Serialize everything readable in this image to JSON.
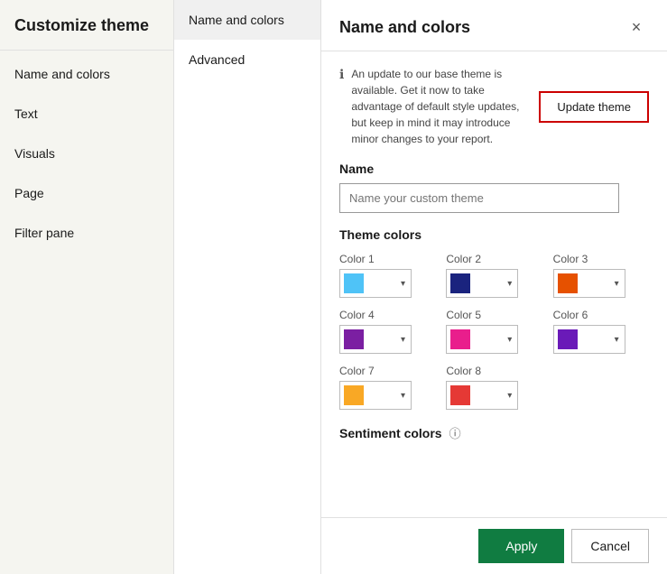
{
  "sidebar": {
    "title": "Customize theme",
    "nav_items": [
      {
        "id": "name-and-colors",
        "label": "Name and colors"
      },
      {
        "id": "text",
        "label": "Text"
      },
      {
        "id": "visuals",
        "label": "Visuals"
      },
      {
        "id": "page",
        "label": "Page"
      },
      {
        "id": "filter-pane",
        "label": "Filter pane"
      }
    ]
  },
  "middle_panel": {
    "tabs": [
      {
        "id": "name-and-colors-tab",
        "label": "Name and colors",
        "active": true
      },
      {
        "id": "advanced-tab",
        "label": "Advanced",
        "active": false
      }
    ]
  },
  "main": {
    "title": "Name and colors",
    "close_label": "×",
    "info_text": "An update to our base theme is available. Get it now to take advantage of default style updates, but keep in mind it may introduce minor changes to your report.",
    "update_theme_label": "Update theme",
    "name_section_label": "Name",
    "name_placeholder": "Name your custom theme",
    "theme_colors_label": "Theme colors",
    "colors": [
      {
        "id": "color1",
        "label": "Color 1",
        "value": "#4FC3F7",
        "hex": "#4FC3F7"
      },
      {
        "id": "color2",
        "label": "Color 2",
        "value": "#1A237E",
        "hex": "#1A237E"
      },
      {
        "id": "color3",
        "label": "Color 3",
        "value": "#E65100",
        "hex": "#E65100"
      },
      {
        "id": "color4",
        "label": "Color 4",
        "value": "#7B1FA2",
        "hex": "#7B1FA2"
      },
      {
        "id": "color5",
        "label": "Color 5",
        "value": "#E91E8C",
        "hex": "#E91E8C"
      },
      {
        "id": "color6",
        "label": "Color 6",
        "value": "#6A1AB8",
        "hex": "#6A1AB8"
      },
      {
        "id": "color7",
        "label": "Color 7",
        "value": "#F9A825",
        "hex": "#F9A825"
      },
      {
        "id": "color8",
        "label": "Color 8",
        "value": "#E53935",
        "hex": "#E53935"
      }
    ],
    "sentiment_label": "Sentiment colors",
    "footer": {
      "apply_label": "Apply",
      "cancel_label": "Cancel"
    }
  }
}
